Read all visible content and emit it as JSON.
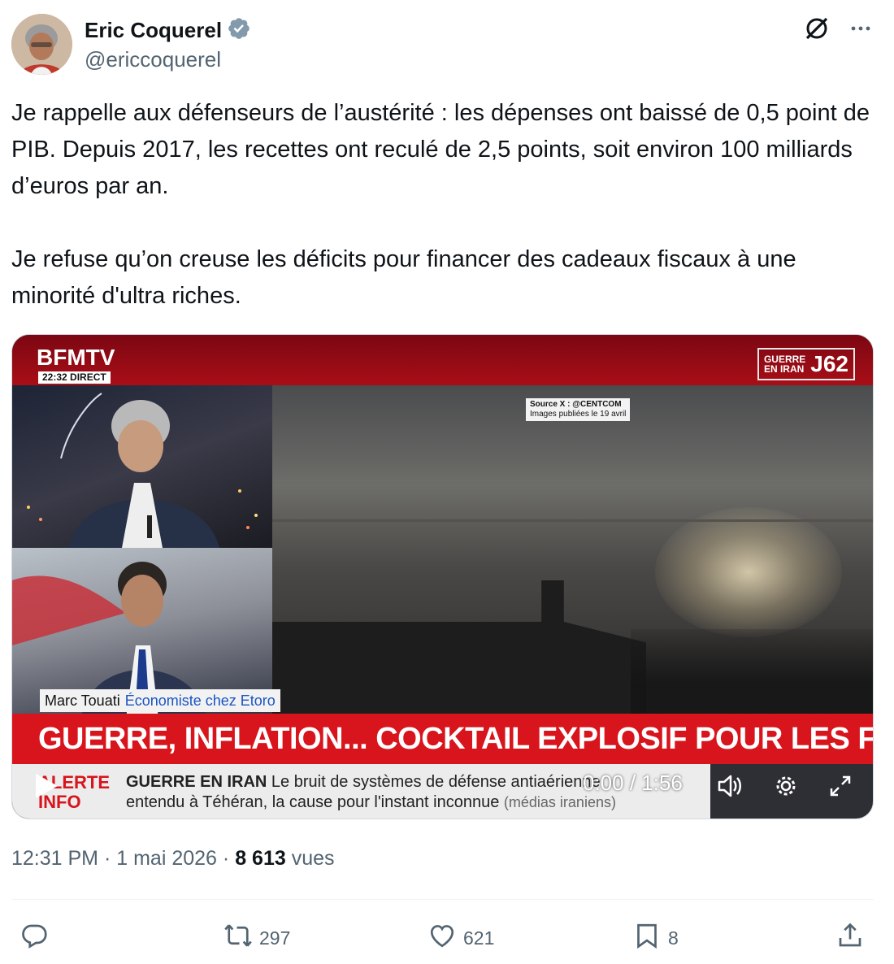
{
  "author": {
    "display_name": "Eric Coquerel",
    "handle": "@ericcoquerel",
    "verified_color": "#829aab"
  },
  "tweet": {
    "paragraphs": [
      "Je rappelle aux défenseurs de l’austérité : les dépenses ont baissé de 0,5 point de PIB. Depuis 2017, les recettes ont reculé de 2,5 points, soit environ 100 milliards d’euros par an.",
      "Je refuse qu’on creuse les déficits pour financer des cadeaux fiscaux à une minorité d'ultra riches."
    ]
  },
  "video": {
    "channel_logo": "BFMTV",
    "channel_time": "22:32  DIRECT",
    "tag_left_line1": "GUERRE",
    "tag_left_line2": "EN IRAN",
    "tag_right": "J62",
    "source_line1": "Source X : @CENTCOM",
    "source_line2": "Images publiées le 19 avril",
    "guest_name": "Marc Touati",
    "guest_role": "Économiste chez Etoro",
    "headline": "GUERRE, INFLATION... COCKTAIL EXPLOSIF POUR LES FRANÇAIS",
    "alert_line1": "ALERTE",
    "alert_line2": "INFO",
    "ticker_keyword": "GUERRE EN IRAN",
    "ticker_line1": "Le bruit de systèmes de défense antiaérienne",
    "ticker_line2": "entendu à Téhéran, la cause pour l'instant inconnue",
    "ticker_source": "(médias iraniens)",
    "time_display": "0:00 / 1:56",
    "colors": {
      "red": "#d8141c",
      "dark_red": "#7c0712"
    }
  },
  "meta": {
    "time": "12:31 PM",
    "date": "1 mai 2026",
    "views_count": "8 613",
    "views_label": "vues",
    "separator": "·"
  },
  "actions": {
    "reply_count": "",
    "retweet_count": "297",
    "like_count": "621",
    "bookmark_count": "8"
  },
  "icons": {
    "top_right": [
      "grok-icon",
      "more-icon"
    ],
    "actions": [
      "reply-icon",
      "retweet-icon",
      "like-icon",
      "bookmark-icon",
      "share-icon"
    ],
    "player": [
      "play-icon",
      "volume-icon",
      "settings-icon",
      "fullscreen-icon"
    ]
  }
}
